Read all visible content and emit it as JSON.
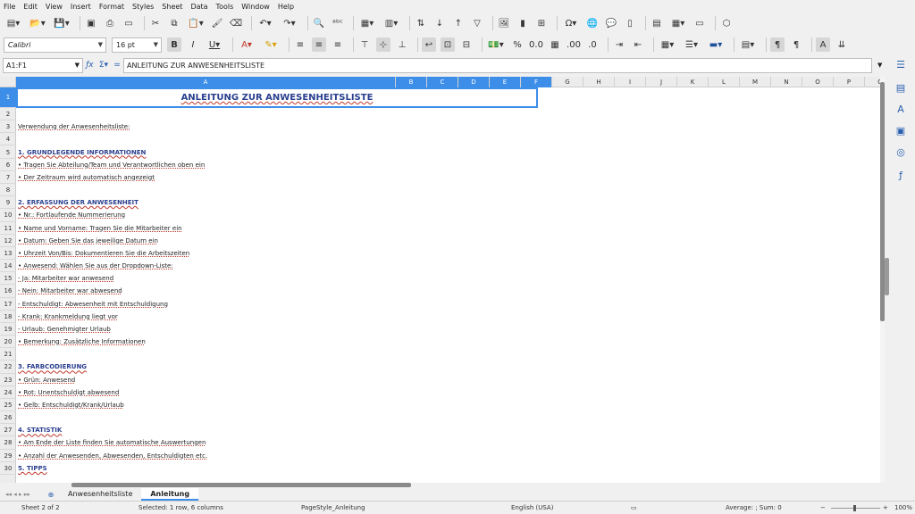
{
  "menu": [
    "File",
    "Edit",
    "View",
    "Insert",
    "Format",
    "Styles",
    "Sheet",
    "Data",
    "Tools",
    "Window",
    "Help"
  ],
  "font_name": "Calibri",
  "font_size": "16 pt",
  "name_box": "A1:F1",
  "formula_content": "ANLEITUNG ZUR ANWESENHEITSLISTE",
  "columns": [
    "A",
    "B",
    "C",
    "D",
    "E",
    "F",
    "G",
    "H",
    "I",
    "J",
    "K",
    "L",
    "M",
    "N",
    "O",
    "P",
    "Q"
  ],
  "rows": [
    "1",
    "2",
    "3",
    "4",
    "5",
    "6",
    "7",
    "8",
    "9",
    "10",
    "11",
    "12",
    "13",
    "14",
    "15",
    "16",
    "17",
    "18",
    "19",
    "20",
    "21",
    "22",
    "23",
    "24",
    "25",
    "26",
    "27",
    "28",
    "29",
    "30"
  ],
  "title": "ANLEITUNG ZUR ANWESENHEITSLISTE",
  "lines": [
    {
      "row": 3,
      "text": "Verwendung der Anwesenheitsliste:",
      "head": false
    },
    {
      "row": 5,
      "text": "1. GRUNDLEGENDE INFORMATIONEN",
      "head": true
    },
    {
      "row": 6,
      "text": "  • Tragen Sie Abteilung/Team und Verantwortlichen oben ein",
      "head": false
    },
    {
      "row": 7,
      "text": "  • Der Zeitraum wird automatisch angezeigt",
      "head": false
    },
    {
      "row": 9,
      "text": "2. ERFASSUNG DER ANWESENHEIT",
      "head": true
    },
    {
      "row": 10,
      "text": "  • Nr.: Fortlaufende Nummerierung",
      "head": false
    },
    {
      "row": 11,
      "text": "  • Name und Vorname: Tragen Sie die Mitarbeiter ein",
      "head": false
    },
    {
      "row": 12,
      "text": "  • Datum: Geben Sie das jeweilige Datum ein",
      "head": false
    },
    {
      "row": 13,
      "text": "  • Uhrzeit Von/Bis: Dokumentieren Sie die Arbeitszeiten",
      "head": false
    },
    {
      "row": 14,
      "text": "  • Anwesend: Wählen Sie aus der Dropdown-Liste:",
      "head": false
    },
    {
      "row": 15,
      "text": "    - Ja: Mitarbeiter war anwesend",
      "head": false
    },
    {
      "row": 16,
      "text": "    - Nein: Mitarbeiter war abwesend",
      "head": false
    },
    {
      "row": 17,
      "text": "    - Entschuldigt: Abwesenheit mit Entschuldigung",
      "head": false
    },
    {
      "row": 18,
      "text": "    - Krank: Krankmeldung liegt vor",
      "head": false
    },
    {
      "row": 19,
      "text": "    - Urlaub: Genehmigter Urlaub",
      "head": false
    },
    {
      "row": 20,
      "text": "  • Bemerkung: Zusätzliche Informationen",
      "head": false
    },
    {
      "row": 22,
      "text": "3. FARBCODIERUNG",
      "head": true
    },
    {
      "row": 23,
      "text": "  • Grün: Anwesend",
      "head": false
    },
    {
      "row": 24,
      "text": "  • Rot: Unentschuldigt abwesend",
      "head": false
    },
    {
      "row": 25,
      "text": "  • Gelb: Entschuldigt/Krank/Urlaub",
      "head": false
    },
    {
      "row": 27,
      "text": "4. STATISTIK",
      "head": true
    },
    {
      "row": 28,
      "text": "  • Am Ende der Liste finden Sie automatische Auswertungen",
      "head": false
    },
    {
      "row": 29,
      "text": "  • Anzahl der Anwesenden, Abwesenden, Entschuldigten etc.",
      "head": false
    },
    {
      "row": 30,
      "text": "5. TIPPS",
      "head": true
    }
  ],
  "tabs": [
    "Anwesenheitsliste",
    "Anleitung"
  ],
  "active_tab": "Anleitung",
  "status": {
    "sheet": "Sheet 2 of 2",
    "selection": "Selected: 1 row, 6 columns",
    "page_style": "PageStyle_Anleitung",
    "language": "English (USA)",
    "sum": "Average: ; Sum: 0",
    "zoom": "100%"
  }
}
